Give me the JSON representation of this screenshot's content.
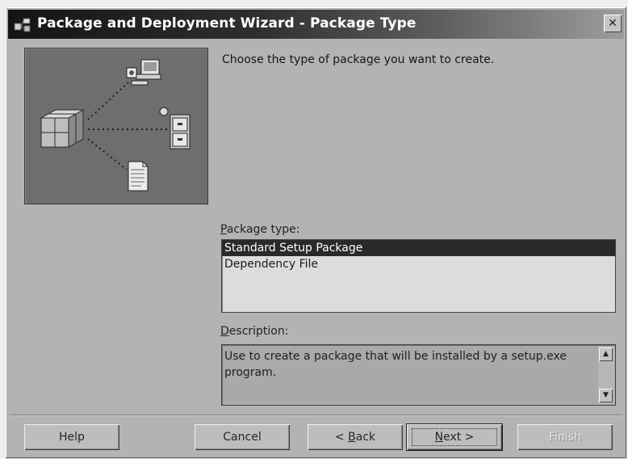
{
  "window": {
    "title": "Package and Deployment Wizard - Package Type",
    "close_label": "✕"
  },
  "instruction": "Choose the type of package you want to create.",
  "package_type": {
    "label_accel": "P",
    "label_rest": "ackage type:",
    "items": [
      {
        "label": "Standard Setup Package",
        "selected": true
      },
      {
        "label": "Dependency File",
        "selected": false
      }
    ]
  },
  "description": {
    "label_accel": "D",
    "label_rest": "escription:",
    "text": "Use to create a package that will be installed by a setup.exe program."
  },
  "buttons": {
    "help": "Help",
    "cancel": "Cancel",
    "back_prefix": "< ",
    "back_accel": "B",
    "back_rest": "ack",
    "next_accel": "N",
    "next_rest": "ext >",
    "finish": "Finish"
  },
  "icons": {
    "title": "package-wizard-icon",
    "illustration": [
      "package-box-icon",
      "computer-icon",
      "file-cabinet-icon",
      "document-icon"
    ],
    "scroll_up": "scroll-up-arrow-icon",
    "scroll_down": "scroll-down-arrow-icon"
  },
  "colors": {
    "title_start": "#141414",
    "title_end": "#9d9d9d",
    "dialog_bg": "#b3b3b1",
    "selection": "#2a2a2a"
  }
}
